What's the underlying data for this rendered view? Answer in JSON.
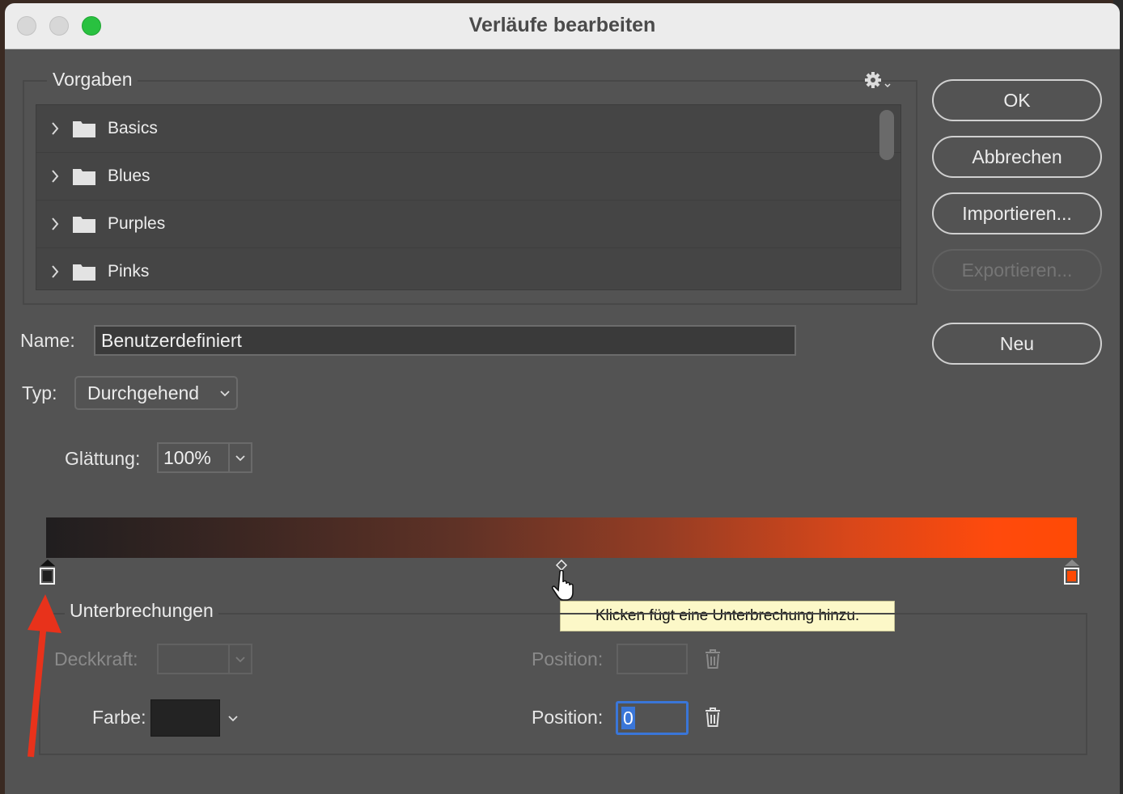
{
  "window": {
    "title": "Verläufe bearbeiten"
  },
  "presets": {
    "group_label": "Vorgaben",
    "gear_icon": "gear-icon",
    "items": [
      {
        "label": "Basics"
      },
      {
        "label": "Blues"
      },
      {
        "label": "Purples"
      },
      {
        "label": "Pinks"
      }
    ]
  },
  "buttons": {
    "ok": "OK",
    "cancel": "Abbrechen",
    "import": "Importieren...",
    "export": "Exportieren...",
    "new": "Neu"
  },
  "name": {
    "label": "Name:",
    "value": "Benutzerdefiniert"
  },
  "type": {
    "label": "Typ:",
    "value": "Durchgehend"
  },
  "smoothness": {
    "label": "Glättung:",
    "value": "100%"
  },
  "gradient": {
    "start_color": "#1f1f1f",
    "end_color": "#ff4a05",
    "tooltip": "Klicken fügt eine Unterbrechung hinzu."
  },
  "stops": {
    "group_label": "Unterbrechungen",
    "opacity_label": "Deckkraft:",
    "opacity_value": "",
    "opacity_position_label": "Position:",
    "opacity_position_value": "",
    "color_label": "Farbe:",
    "color_value": "#232323",
    "color_position_label": "Position:",
    "color_position_value": "0"
  },
  "colors": {
    "dialog_bg": "#535353",
    "list_bg": "#454545",
    "accent_focus": "#3a76d8",
    "annotation_arrow": "#e8321b"
  }
}
